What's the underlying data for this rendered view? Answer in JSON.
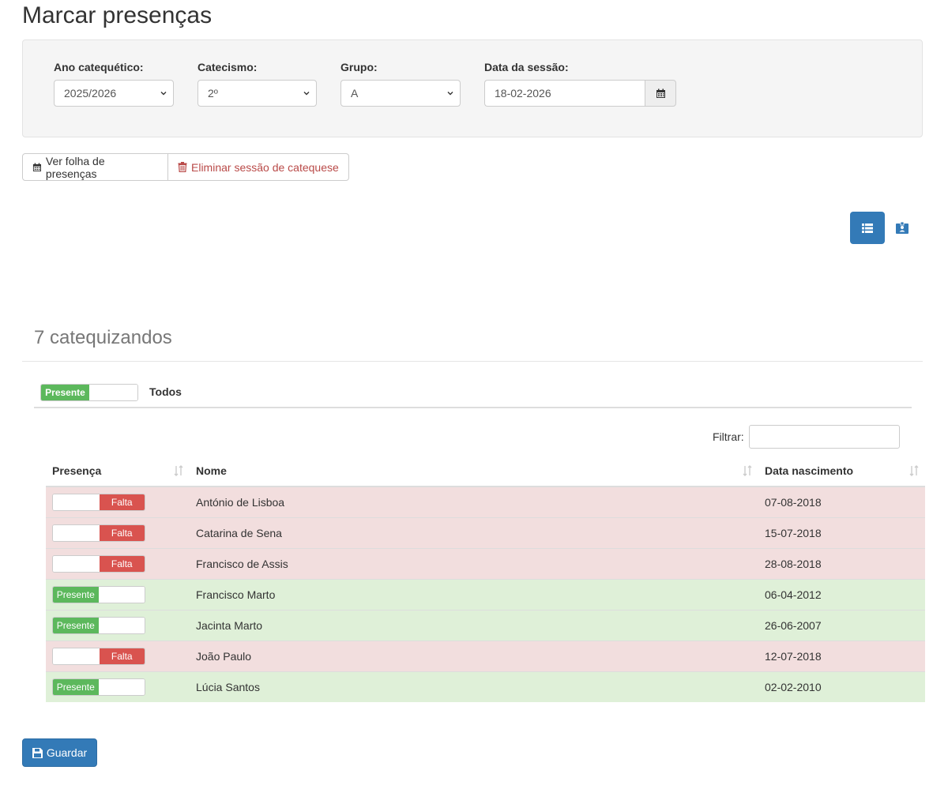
{
  "page": {
    "title": "Marcar presenças"
  },
  "filters": {
    "ano_label": "Ano catequético:",
    "ano_value": "2025/2026",
    "catecismo_label": "Catecismo:",
    "catecismo_value": "2º",
    "grupo_label": "Grupo:",
    "grupo_value": "A",
    "data_label": "Data da sessão:",
    "data_value": "18-02-2026"
  },
  "actions": {
    "ver_folha": "Ver folha de presenças",
    "eliminar": "Eliminar sessão de catequese"
  },
  "summary": {
    "count_title": "7 catequizandos"
  },
  "toggle_all": {
    "state_label": "Presente",
    "label": "Todos"
  },
  "table": {
    "filter_label": "Filtrar:",
    "headers": {
      "presenca": "Presença",
      "nome": "Nome",
      "nascimento": "Data nascimento"
    },
    "present_label": "Presente",
    "absent_label": "Falta",
    "rows": [
      {
        "status": "absent",
        "status_label": "Falta",
        "nome": "António de Lisboa",
        "nascimento": "07-08-2018"
      },
      {
        "status": "absent",
        "status_label": "Falta",
        "nome": "Catarina de Sena",
        "nascimento": "15-07-2018"
      },
      {
        "status": "absent",
        "status_label": "Falta",
        "nome": "Francisco de Assis",
        "nascimento": "28-08-2018"
      },
      {
        "status": "present",
        "status_label": "Presente",
        "nome": "Francisco Marto",
        "nascimento": "06-04-2012"
      },
      {
        "status": "present",
        "status_label": "Presente",
        "nome": "Jacinta Marto",
        "nascimento": "26-06-2007"
      },
      {
        "status": "absent",
        "status_label": "Falta",
        "nome": "João Paulo",
        "nascimento": "12-07-2018"
      },
      {
        "status": "present",
        "status_label": "Presente",
        "nome": "Lúcia Santos",
        "nascimento": "02-02-2010"
      }
    ]
  },
  "footer": {
    "save_label": "Guardar"
  },
  "colors": {
    "primary": "#337ab7",
    "success": "#5cb85c",
    "danger": "#d9534f",
    "row_absent": "#f2dede",
    "row_present": "#dff0d8"
  },
  "icons": {
    "calendar": "calendar-icon",
    "trash": "trash-icon",
    "list_view": "list-view-icon",
    "card_view": "id-card-icon",
    "save": "floppy-disk-icon",
    "sort": "sort-icon"
  }
}
